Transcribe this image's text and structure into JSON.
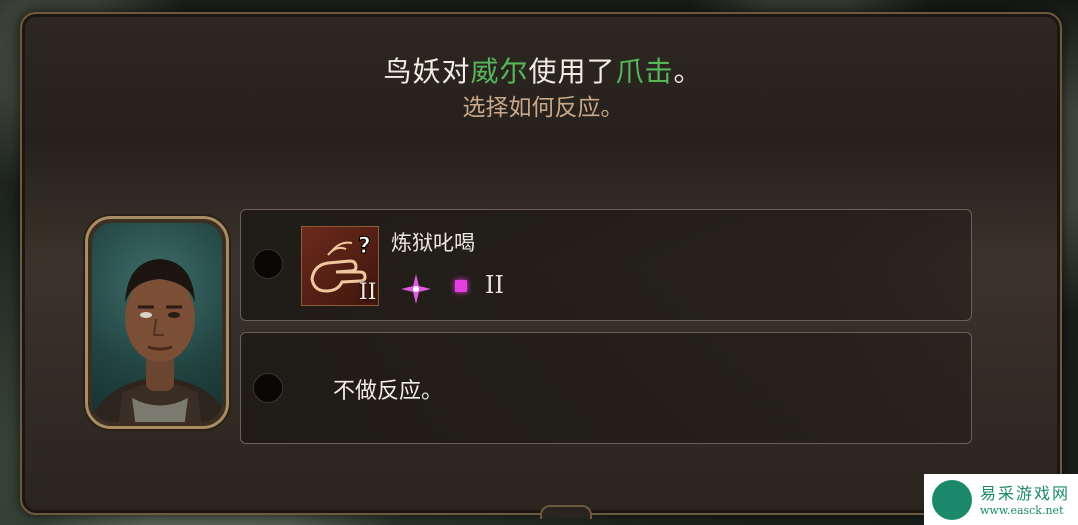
{
  "header": {
    "title_prefix": "鸟妖对",
    "title_target": "威尔",
    "title_mid": "使用了",
    "title_action": "爪击",
    "title_suffix": "。",
    "subtitle": "选择如何反应。",
    "highlight_color": "#57b65a"
  },
  "portrait": {
    "icon": "character-portrait"
  },
  "options": [
    {
      "skill_name": "炼狱叱喝",
      "skill_icon": "hand-gesture-icon",
      "skill_level": "II",
      "cost_icon": "sparkle-icon",
      "slot_icon": "spell-slot-icon",
      "slot_level": "II",
      "slot_color": "#e63ee0"
    },
    {
      "label": "不做反应。"
    }
  ],
  "watermark": {
    "text": "易采游戏网",
    "url": "www.easck.net"
  }
}
